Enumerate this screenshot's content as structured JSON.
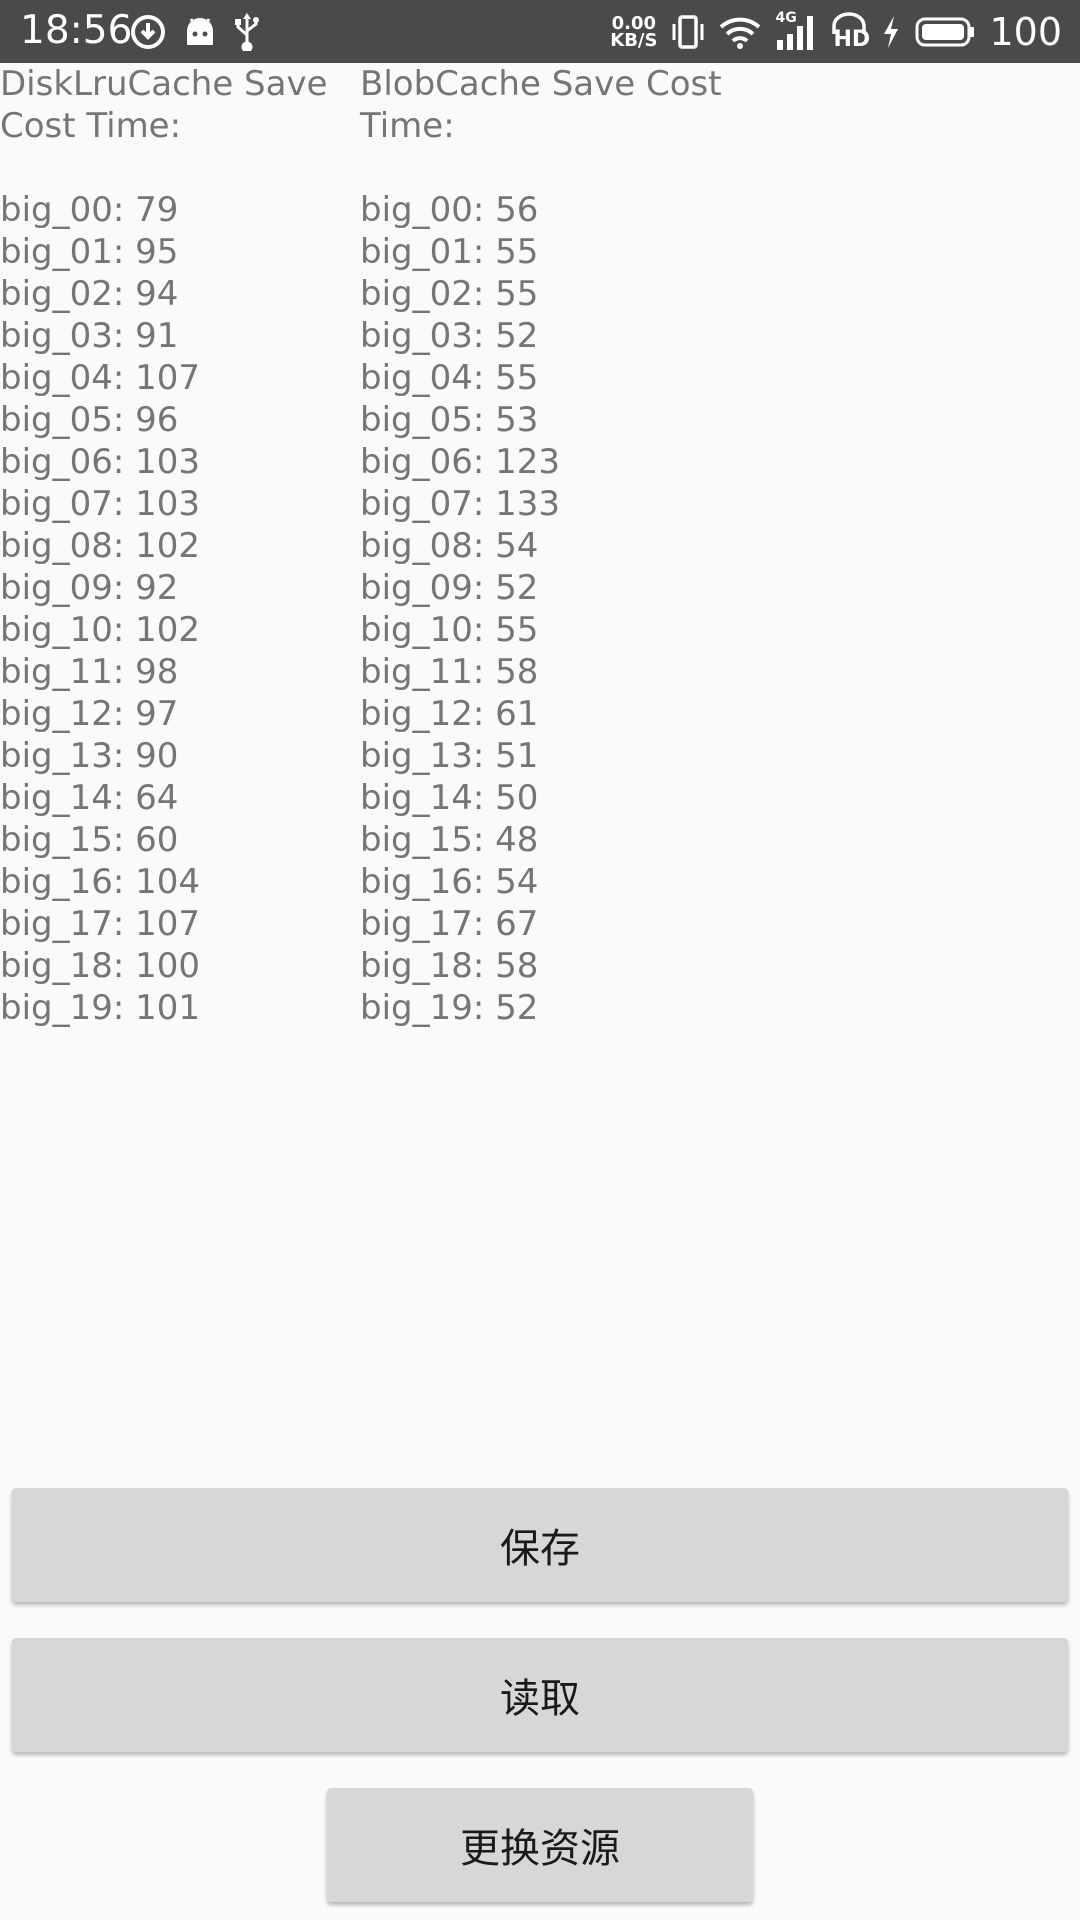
{
  "status_bar": {
    "time": "18:56",
    "left_icons": [
      "download-icon",
      "android-icon",
      "usb-icon"
    ],
    "net_speed_value": "0.00",
    "net_speed_unit": "KB/S",
    "right_icons": [
      "vibrate-icon",
      "wifi-icon",
      "signal-4g-icon",
      "hd-icon",
      "charging-icon",
      "battery-icon"
    ],
    "signal_label": "4G",
    "hd_label": "HD",
    "battery_level": "100"
  },
  "left_column": {
    "title": "DiskLruCache Save Cost Time:",
    "rows": [
      "big_00: 79",
      "big_01: 95",
      "big_02: 94",
      "big_03: 91",
      "big_04: 107",
      "big_05: 96",
      "big_06: 103",
      "big_07: 103",
      "big_08: 102",
      "big_09: 92",
      "big_10: 102",
      "big_11: 98",
      "big_12: 97",
      "big_13: 90",
      "big_14: 64",
      "big_15: 60",
      "big_16: 104",
      "big_17: 107",
      "big_18: 100",
      "big_19: 101"
    ]
  },
  "right_column": {
    "title": "BlobCache Save Cost Time:",
    "rows": [
      "big_00: 56",
      "big_01: 55",
      "big_02: 55",
      "big_03: 52",
      "big_04: 55",
      "big_05: 53",
      "big_06: 123",
      "big_07: 133",
      "big_08: 54",
      "big_09: 52",
      "big_10: 55",
      "big_11: 58",
      "big_12: 61",
      "big_13: 51",
      "big_14: 50",
      "big_15: 48",
      "big_16: 54",
      "big_17: 67",
      "big_18: 58",
      "big_19: 52"
    ]
  },
  "buttons": {
    "save_label": "保存",
    "read_label": "读取",
    "change_resource_label": "更换资源"
  }
}
